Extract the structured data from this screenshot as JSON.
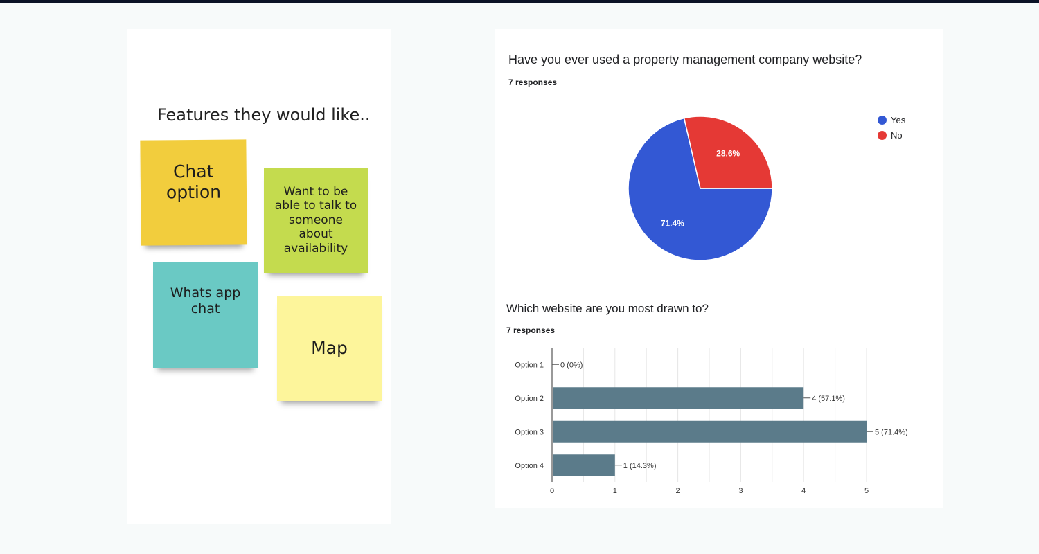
{
  "left": {
    "title": "Features they would like..",
    "notes": [
      {
        "text": "Chat option",
        "color": "#f2cd3d"
      },
      {
        "text": "Want to be able to talk to someone about availability",
        "color": "#c4db4e"
      },
      {
        "text": "Whats app chat",
        "color": "#6ac9c4"
      },
      {
        "text": "Map",
        "color": "#fdf59b"
      }
    ]
  },
  "pie": {
    "question": "Have you ever used a property management company website?",
    "responses": "7 responses"
  },
  "bar": {
    "question": "Which website are you most drawn to?",
    "responses": "7 responses"
  },
  "chart_data": [
    {
      "type": "pie",
      "title": "Have you ever used a property management company website?",
      "subtitle": "7 responses",
      "slices": [
        {
          "label": "Yes",
          "value": 71.4,
          "display": "71.4%",
          "color": "#3358d4"
        },
        {
          "label": "No",
          "value": 28.6,
          "display": "28.6%",
          "color": "#e53935"
        }
      ],
      "legend_position": "top-right"
    },
    {
      "type": "bar",
      "orientation": "horizontal",
      "title": "Which website are you most drawn to?",
      "subtitle": "7 responses",
      "categories": [
        "Option 1",
        "Option 2",
        "Option 3",
        "Option 4"
      ],
      "values": [
        0,
        4,
        5,
        1
      ],
      "data_labels": [
        "0 (0%)",
        "4 (57.1%)",
        "5 (71.4%)",
        "1 (14.3%)"
      ],
      "xlim": [
        0,
        5
      ],
      "xticks": [
        "0",
        "1",
        "2",
        "3",
        "4",
        "5"
      ],
      "grid": true,
      "color": "#5b7b8a"
    }
  ]
}
